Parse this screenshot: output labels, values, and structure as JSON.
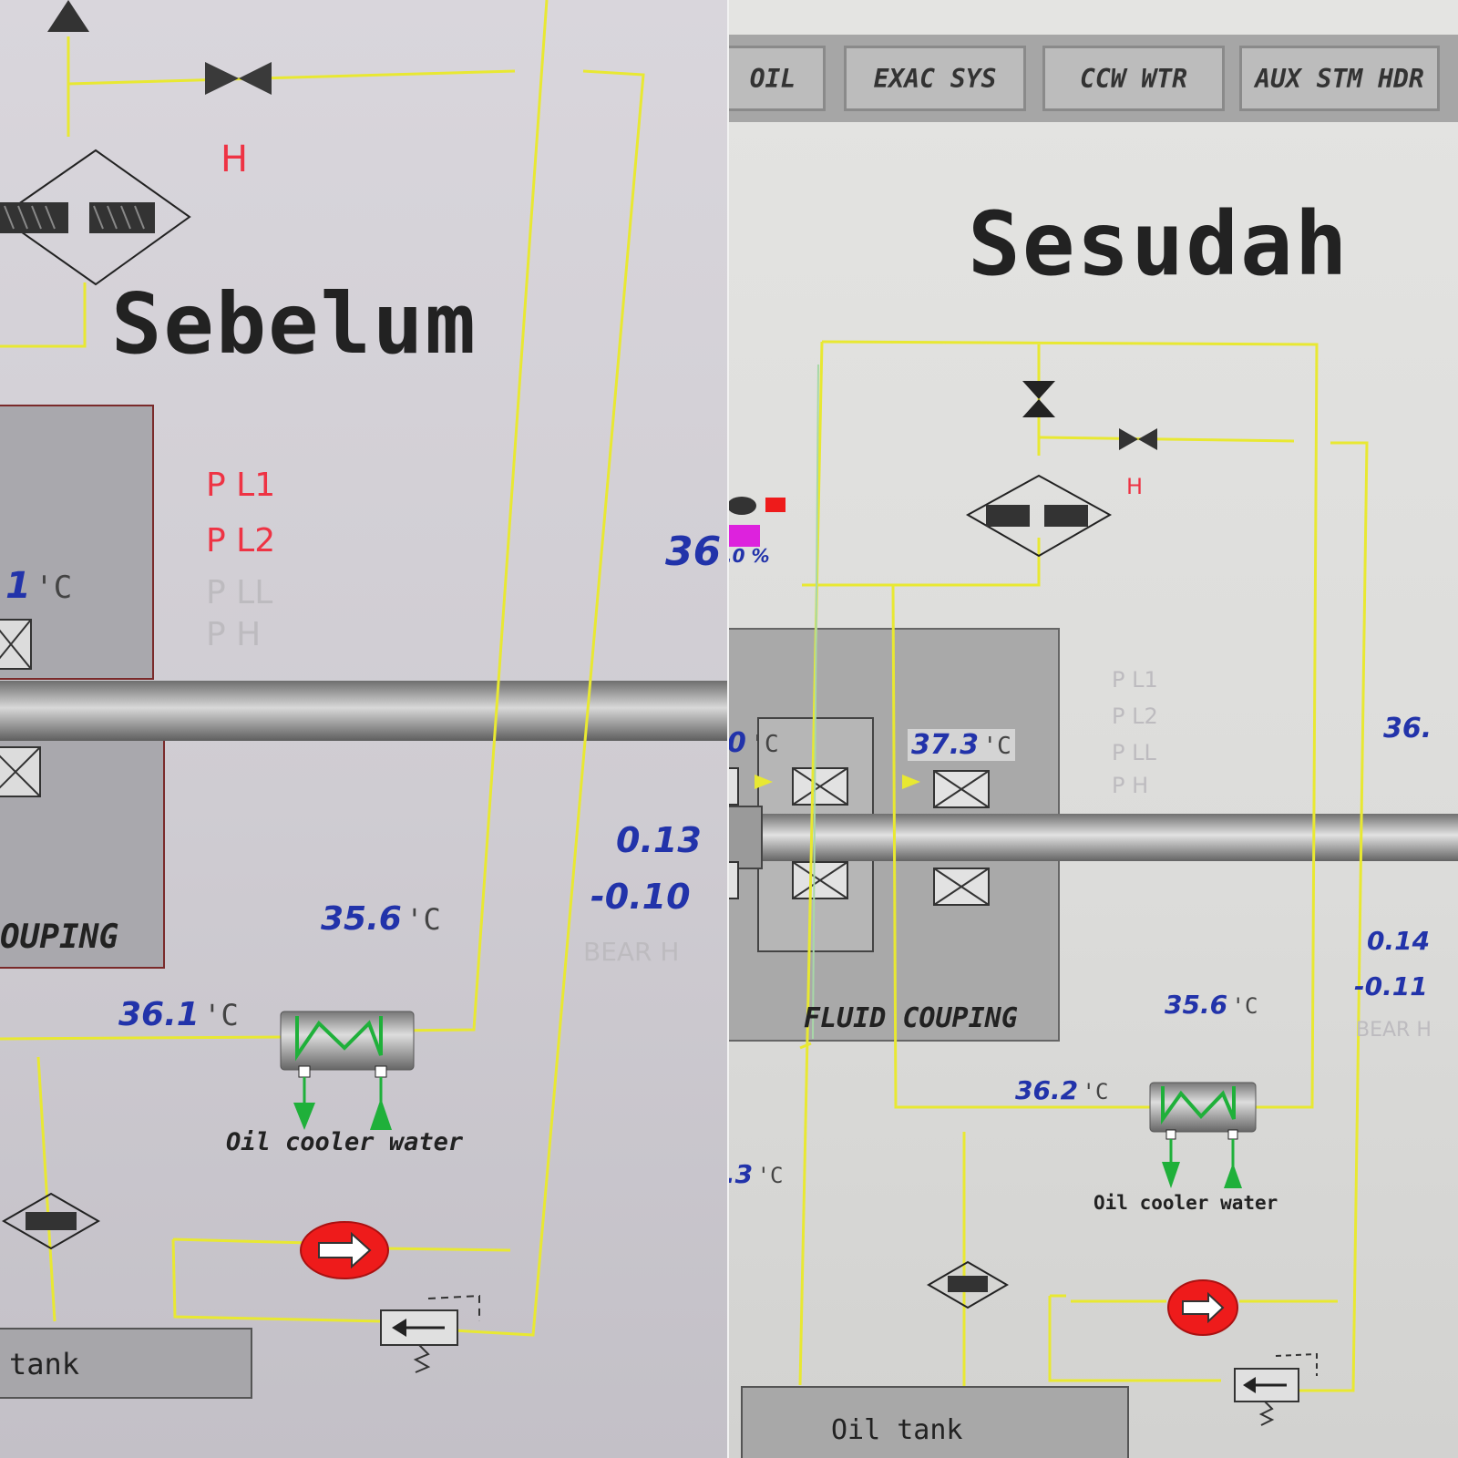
{
  "left": {
    "title": "Sebelum",
    "alarm_flag": "H",
    "pressure_labels": [
      "P L1",
      "P L2",
      "P LL",
      "P H"
    ],
    "temp_top": {
      "value": "1",
      "unit": "'C"
    },
    "coupling_label": "OUPING",
    "vib_1": "0.13",
    "vib_2": "-0.10",
    "bear_label": "BEAR H",
    "value_36": "36",
    "temp_356": {
      "value": "35.6",
      "unit": "'C"
    },
    "temp_361": {
      "value": "36.1",
      "unit": "'C"
    },
    "cooler_label": "Oil cooler water",
    "tank_label": "tank"
  },
  "right": {
    "title": "Sesudah",
    "tabs": [
      "OIL",
      "EXAC SYS",
      "CCW WTR",
      "AUX STM HDR"
    ],
    "alarm_flag": "H",
    "percent_readout": ".0 %",
    "pressure_labels": [
      "P L1",
      "P L2",
      "P LL",
      "P H"
    ],
    "temp_left": {
      "value": "0",
      "unit": "'C"
    },
    "temp_373": {
      "value": "37.3",
      "unit": "'C"
    },
    "value_36": "36.",
    "coupling_label": "FLUID COUPING",
    "vib_1": "0.14",
    "vib_2": "-0.11",
    "bear_label": "BEAR H",
    "temp_356": {
      "value": "35.6",
      "unit": "'C"
    },
    "temp_362": {
      "value": "36.2",
      "unit": "'C"
    },
    "temp_73": {
      "value": ".3",
      "unit": "'C"
    },
    "cooler_label": "Oil cooler water",
    "tank_label": "Oil tank"
  },
  "colors": {
    "pipe": "#e8e832",
    "alarm": "#ee3344",
    "value": "#2233aa",
    "pump": "#ee1b1b",
    "cooler_coil": "#1fb03a"
  }
}
